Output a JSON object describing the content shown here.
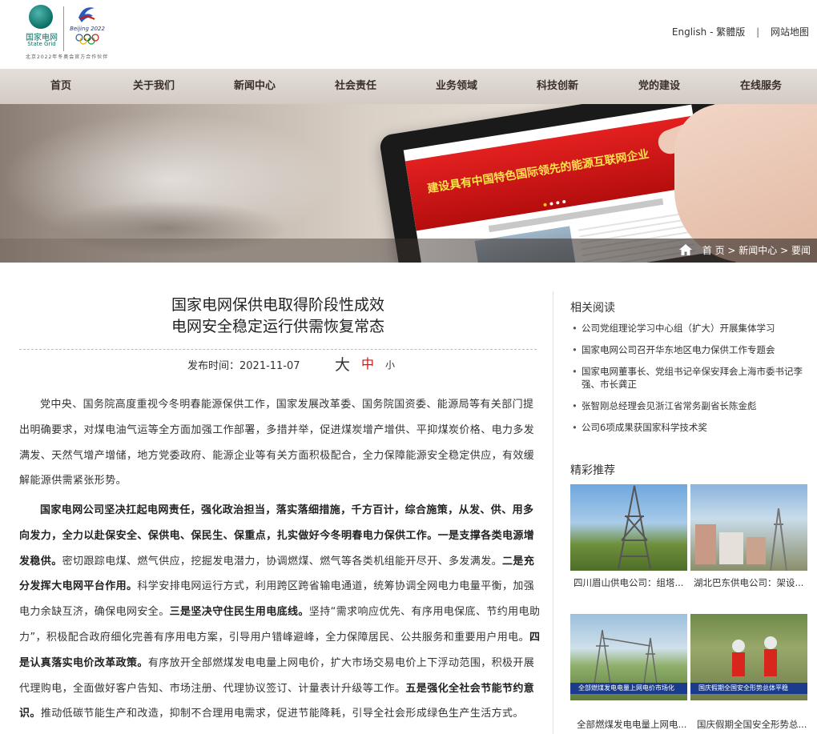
{
  "header": {
    "logo_sgcc_cn": "国家电网",
    "logo_sgcc_en": "State Grid",
    "logo_beijing": "Beijing 2022",
    "logo_caption": "北京2022年冬奥会官方合作伙伴",
    "links": {
      "english": "English",
      "dash": "-",
      "traditional": "繁體版",
      "sep": "|",
      "sitemap": "网站地图"
    }
  },
  "nav": {
    "items": [
      "首页",
      "关于我们",
      "新闻中心",
      "社会责任",
      "业务领域",
      "科技创新",
      "党的建设",
      "在线服务"
    ]
  },
  "banner": {
    "screen_slogan": "建设具有中国特色国际领先的能源互联网企业"
  },
  "breadcrumb": {
    "home": "首 页",
    "sep1": " > ",
    "news": "新闻中心",
    "sep2": " > ",
    "current": "要闻"
  },
  "article": {
    "title_line1": "国家电网保供电取得阶段性成效",
    "title_line2": "电网安全稳定运行供需恢复常态",
    "publish_label": "发布时间：",
    "publish_date": "2021-11-07",
    "font_large": "大",
    "font_medium": "中",
    "font_small": "小",
    "p1": "党中央、国务院高度重视今冬明春能源保供工作，国家发展改革委、国务院国资委、能源局等有关部门提出明确要求，对煤电油气运等全方面加强工作部署，多措并举，促进煤炭增产增供、平抑煤炭价格、电力多发满发、天然气增产增储，地方党委政府、能源企业等有关方面积极配合，全力保障能源安全稳定供应，有效缓解能源供需紧张形势。",
    "p2_b1": "国家电网公司坚决扛起电网责任，强化政治担当，落实落细措施，千方百计，综合施策，从发、供、用多向发力，全力以赴保安全、保供电、保民生、保重点，扎实做好今冬明春电力保供工作。一是支撑各类电源增发稳供。",
    "p2_t1": "密切跟踪电煤、燃气供应，挖掘发电潜力，协调燃煤、燃气等各类机组能开尽开、多发满发。",
    "p2_b2": "二是充分发挥大电网平台作用。",
    "p2_t2": "科学安排电网运行方式，利用跨区跨省输电通道，统筹协调全网电力电量平衡，加强电力余缺互济，确保电网安全。",
    "p2_b3": "三是坚决守住民生用电底线。",
    "p2_t3": "坚持“需求响应优先、有序用电保底、节约用电助力”，积极配合政府细化完善有序用电方案，引导用户错峰避峰，全力保障居民、公共服务和重要用户用电。",
    "p2_b4": "四是认真落实电价改革政策。",
    "p2_t4": "有序放开全部燃煤发电电量上网电价，扩大市场交易电价上下浮动范围，积极开展代理购电，全面做好客户告知、市场注册、代理协议签订、计量表计升级等工作。",
    "p2_b5": "五是强化全社会节能节约意识。",
    "p2_t5": "推动低碳节能生产和改造，抑制不合理用电需求，促进节能降耗，引导全社会形成绿色生产生活方式。"
  },
  "sidebar": {
    "related_title": "相关阅读",
    "related": [
      "公司党组理论学习中心组（扩大）开展集体学习",
      "国家电网公司召开华东地区电力保供工作专题会",
      "国家电网董事长、党组书记辛保安拜会上海市委书记李强、市长龚正",
      "张智刚总经理会见浙江省常务副省长陈金彪",
      "公司6项成果获国家科学技术奖"
    ],
    "featured_title": "精彩推荐",
    "featured": [
      {
        "caption": "四川眉山供电公司：组塔..."
      },
      {
        "caption": "湖北巴东供电公司：架设..."
      },
      {
        "caption": "全部燃煤发电电量上网电...",
        "strip": "全部燃煤发电电量上网电价市场化"
      },
      {
        "caption": "国庆假期全国安全形势总...",
        "strip": "国庆假期全国安全形势总体平稳"
      }
    ]
  },
  "colors": {
    "accent_red": "#d8120f",
    "nav_bg": "#d9d2ca",
    "sgcc_green": "#0a6f66"
  }
}
